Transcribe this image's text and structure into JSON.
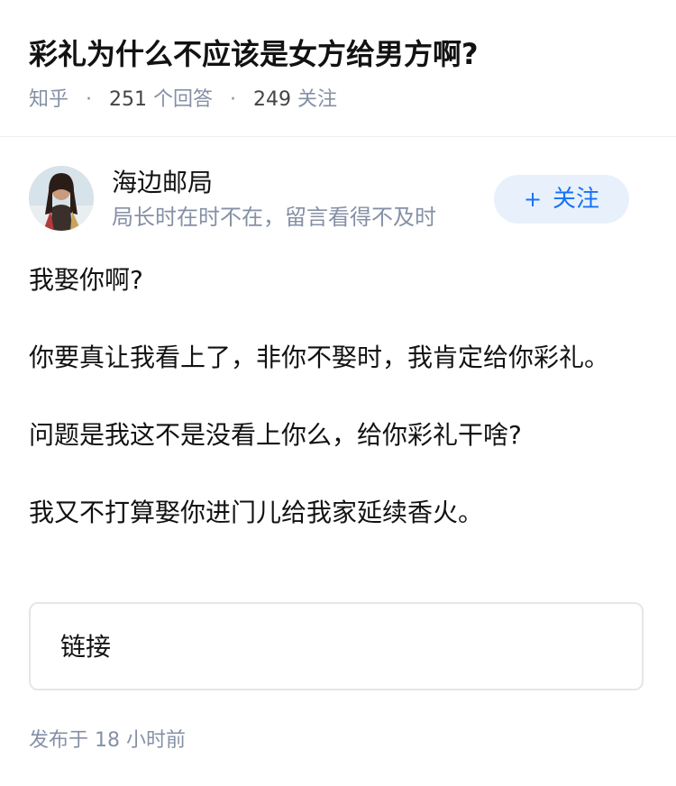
{
  "question": {
    "title": "彩礼为什么不应该是女方给男方啊?",
    "source": "知乎",
    "answers_count": "251",
    "answers_label": "个回答",
    "followers_count": "249",
    "followers_label": "关注"
  },
  "author": {
    "name": "海边邮局",
    "bio": "局长时在时不在，留言看得不及时",
    "avatar_icon": "avatar-photo",
    "follow_button": {
      "plus": "+",
      "label": "关注"
    }
  },
  "answer": {
    "paragraphs": [
      "我娶你啊?",
      "你要真让我看上了，非你不娶时，我肯定给你彩礼。",
      "问题是我这不是没看上你么，给你彩礼干啥?",
      "我又不打算娶你进门儿给我家延续香火。"
    ],
    "link_card_label": "链接"
  },
  "footer": {
    "published_prefix": "发布于",
    "published_time": "18 小时前"
  },
  "colors": {
    "text": "#121212",
    "meta": "#8590a6",
    "accent": "#1772f6",
    "follow_bg": "#e8f1fb"
  }
}
